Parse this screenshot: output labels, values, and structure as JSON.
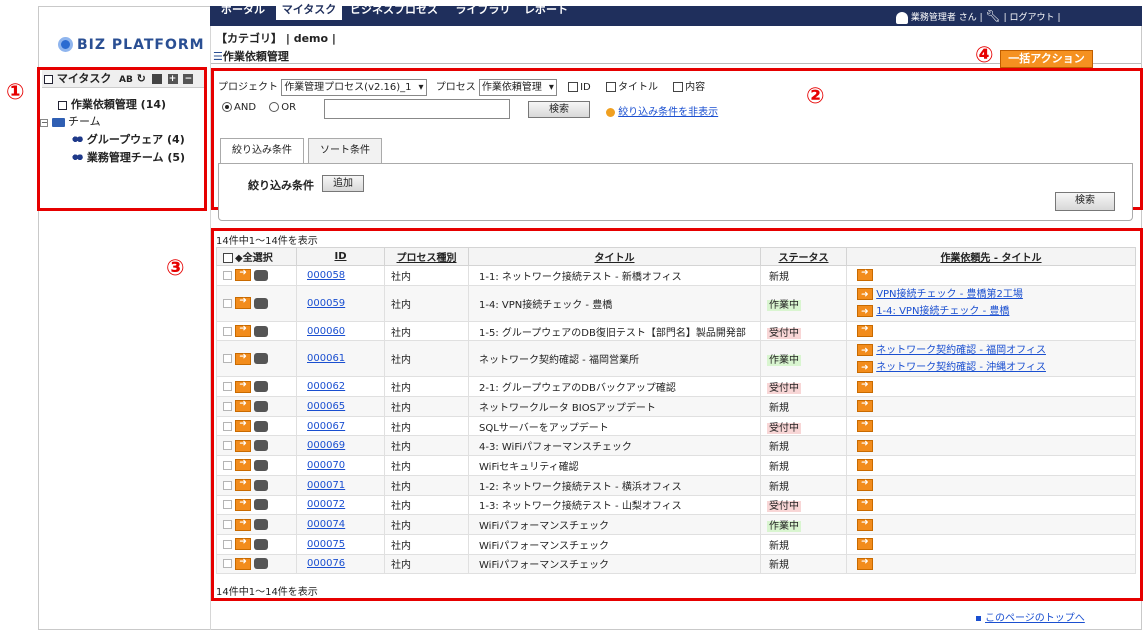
{
  "nav": {
    "tabs": [
      "ポータル",
      "マイタスク",
      "ビジネスプロセス",
      "ライブラリ",
      "レポート"
    ],
    "active": "マイタスク",
    "user": "業務管理者 さん",
    "logout": "ログアウト"
  },
  "logo": "BIZ PLATFORM",
  "breadcrumb": {
    "category": "【カテゴリ】",
    "sep": "|",
    "name": "demo",
    "sep2": "|"
  },
  "page_title": "作業依頼管理",
  "annotations": {
    "n1": "①",
    "n2": "②",
    "n3": "③",
    "n4": "④"
  },
  "bulk_action": "一括アクション",
  "tree": {
    "head": "マイタスク",
    "root": "作業依頼管理 (14)",
    "team_folder": "チーム",
    "teams": [
      "グループウェア (4)",
      "業務管理チーム (5)"
    ]
  },
  "search": {
    "project_label": "プロジェクト",
    "project_value": "作業管理プロセス(v2.16)_1",
    "process_label": "プロセス",
    "process_value": "作業依頼管理",
    "checks": [
      "ID",
      "タイトル",
      "内容"
    ],
    "and_label": "AND",
    "or_label": "OR",
    "keyword_value": "",
    "search_button": "検索",
    "hide_filter_link": "絞り込み条件を非表示"
  },
  "filter_tabs": [
    "絞り込み条件",
    "ソート条件"
  ],
  "filter": {
    "label": "絞り込み条件",
    "add_button": "追加",
    "search_button": "検索"
  },
  "count_text_top": "14件中1～14件を表示",
  "count_text_bottom": "14件中1～14件を表示",
  "table": {
    "select_all": "◆全選択",
    "columns": [
      "ID",
      "プロセス種別",
      "タイトル",
      "ステータス",
      "作業依頼先 - タイトル"
    ],
    "rows": [
      {
        "id": "000058",
        "type": "社内",
        "title": "1-1: ネットワーク接続テスト - 新橋オフィス",
        "status": "新規",
        "links": []
      },
      {
        "id": "000059",
        "type": "社内",
        "title": "1-4: VPN接続チェック - 豊橋",
        "status": "作業中",
        "links": [
          "VPN接続チェック - 豊橋第2工場",
          "1-4: VPN接続チェック - 豊橋"
        ]
      },
      {
        "id": "000060",
        "type": "社内",
        "title": "1-5: グループウェアのDB復旧テスト【部門名】製品開発部",
        "status": "受付中",
        "links": []
      },
      {
        "id": "000061",
        "type": "社内",
        "title": "ネットワーク契約確認 - 福岡営業所",
        "status": "作業中",
        "links": [
          "ネットワーク契約確認 - 福岡オフィス",
          "ネットワーク契約確認 - 沖縄オフィス"
        ]
      },
      {
        "id": "000062",
        "type": "社内",
        "title": "2-1: グループウェアのDBバックアップ確認",
        "status": "受付中",
        "links": []
      },
      {
        "id": "000065",
        "type": "社内",
        "title": "ネットワークルータ BIOSアップデート",
        "status": "新規",
        "links": []
      },
      {
        "id": "000067",
        "type": "社内",
        "title": "SQLサーバーをアップデート",
        "status": "受付中",
        "links": []
      },
      {
        "id": "000069",
        "type": "社内",
        "title": "4-3: WiFiパフォーマンスチェック",
        "status": "新規",
        "links": []
      },
      {
        "id": "000070",
        "type": "社内",
        "title": "WiFiセキュリティ確認",
        "status": "新規",
        "links": []
      },
      {
        "id": "000071",
        "type": "社内",
        "title": "1-2: ネットワーク接続テスト - 横浜オフィス",
        "status": "新規",
        "links": []
      },
      {
        "id": "000072",
        "type": "社内",
        "title": "1-3: ネットワーク接続テスト - 山梨オフィス",
        "status": "受付中",
        "links": []
      },
      {
        "id": "000074",
        "type": "社内",
        "title": "WiFiパフォーマンスチェック",
        "status": "作業中",
        "links": []
      },
      {
        "id": "000075",
        "type": "社内",
        "title": "WiFiパフォーマンスチェック",
        "status": "新規",
        "links": []
      },
      {
        "id": "000076",
        "type": "社内",
        "title": "WiFiパフォーマンスチェック",
        "status": "新規",
        "links": []
      }
    ]
  },
  "to_top": "このページのトップへ",
  "colors": {
    "nav": "#1f2f5c",
    "highlight_red": "#e60000",
    "accent_orange": "#f59120",
    "link": "#1a4fd0"
  }
}
